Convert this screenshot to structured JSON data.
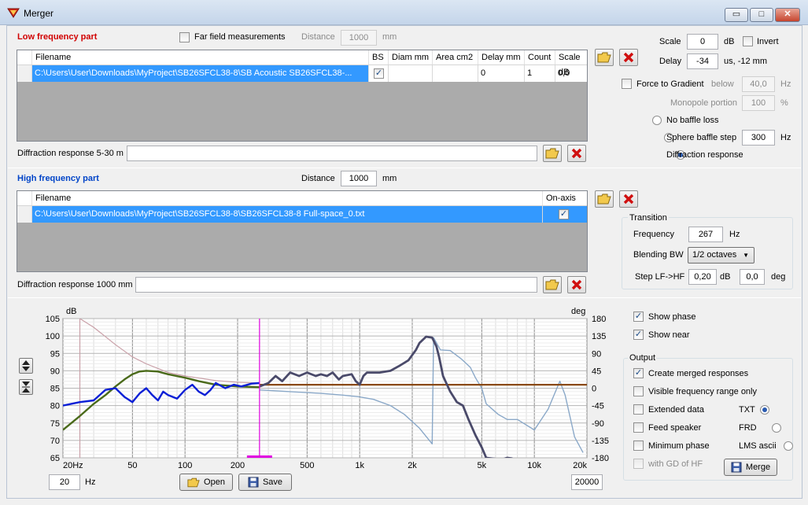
{
  "window": {
    "title": "Merger",
    "btn_min": "▭",
    "btn_max": "□",
    "btn_close": "✕"
  },
  "lf": {
    "title": "Low frequency part",
    "far_field_label": "Far field measurements",
    "distance_label": "Distance",
    "distance_value": "1000",
    "distance_unit": "mm",
    "columns": [
      "Filename",
      "BS",
      "Diam mm",
      "Area cm2",
      "Delay mm",
      "Count",
      "Scale dB"
    ],
    "row": {
      "filename": "C:\\Users\\User\\Downloads\\MyProject\\SB26SFCL38-8\\SB Acoustic SB26SFCL38-...",
      "bs": "✓",
      "diam": "",
      "area": "",
      "delay": "0",
      "count": "1",
      "scale": "0,0"
    },
    "diffraction_label": "Diffraction response 5-30 m",
    "diffraction_value": ""
  },
  "right": {
    "scale_label": "Scale",
    "scale_value": "0",
    "scale_unit": "dB",
    "invert_label": "Invert",
    "delay_label": "Delay",
    "delay_value": "-34",
    "delay_unit": "us, -12 mm",
    "force_label": "Force to Gradient",
    "below_label": "below",
    "below_value": "40,0",
    "below_unit": "Hz",
    "monopole_label": "Monopole portion",
    "monopole_value": "100",
    "monopole_unit": "%",
    "no_baffle": "No baffle loss",
    "sphere": "Sphere baffle step",
    "sphere_value": "300",
    "sphere_unit": "Hz",
    "diffraction": "Diffraction response"
  },
  "hf": {
    "title": "High frequency part",
    "distance_label": "Distance",
    "distance_value": "1000",
    "distance_unit": "mm",
    "columns": [
      "Filename",
      "On-axis"
    ],
    "row": {
      "filename": "C:\\Users\\User\\Downloads\\MyProject\\SB26SFCL38-8\\SB26SFCL38-8 Full-space_0.txt",
      "onaxis": "✓"
    },
    "diffraction_label": "Diffraction response 1000 mm",
    "diffraction_value": ""
  },
  "transition": {
    "title": "Transition",
    "freq_label": "Frequency",
    "freq_value": "267",
    "freq_unit": "Hz",
    "bw_label": "Blending BW",
    "bw_value": "1/2 octaves",
    "step_label": "Step LF->HF",
    "step_db": "0,20",
    "step_db_unit": "dB",
    "step_deg": "0,0",
    "step_deg_unit": "deg"
  },
  "chart_controls": {
    "show_phase": "Show phase",
    "show_near": "Show near",
    "output_title": "Output",
    "create_merged": "Create merged responses",
    "visible_range": "Visible frequency range only",
    "extended": "Extended data",
    "feed": "Feed speaker",
    "minimum_phase": "Minimum phase",
    "gd": "with GD of HF",
    "fmt_txt": "TXT",
    "fmt_frd": "FRD",
    "fmt_lms": "LMS ascii",
    "merge": "Merge",
    "min_freq": "20",
    "min_unit": "Hz",
    "max_freq": "20000",
    "open": "Open",
    "save": "Save"
  },
  "chart_data": {
    "type": "line",
    "ylabel_left": "dB",
    "ylabel_right": "deg",
    "ylim": [
      65,
      105
    ],
    "y_ticks": [
      "105",
      "100",
      "95",
      "90",
      "85",
      "80",
      "75",
      "70",
      "65"
    ],
    "y2lim": [
      -180,
      180
    ],
    "y2_ticks": [
      "180",
      "135",
      "90",
      "45",
      "0",
      "-45",
      "-90",
      "-135",
      "-180"
    ],
    "xlim": [
      20,
      20000
    ],
    "x_scale": "log",
    "x_ticks": [
      {
        "f": 20,
        "label": "20Hz"
      },
      {
        "f": 50,
        "label": "50"
      },
      {
        "f": 100,
        "label": "100"
      },
      {
        "f": 200,
        "label": "200"
      },
      {
        "f": 500,
        "label": "500"
      },
      {
        "f": 1000,
        "label": "1k"
      },
      {
        "f": 2000,
        "label": "2k"
      },
      {
        "f": 5000,
        "label": "5k"
      },
      {
        "f": 10000,
        "label": "10k"
      },
      {
        "f": 20000,
        "label": "20k"
      }
    ],
    "transition_freq": 267,
    "colors": {
      "lf": "#0b1fd6",
      "hf": "#4a4a6a",
      "merged": "#8a4a10",
      "lf_phase": "#c9a0a8",
      "hf_phase": "#8aa8c8",
      "near": "#4a6a1a",
      "marker": "#e000e0"
    },
    "series": [
      {
        "key": "near",
        "points": [
          [
            20,
            73
          ],
          [
            25,
            77
          ],
          [
            30,
            80.5
          ],
          [
            35,
            83
          ],
          [
            40,
            85.5
          ],
          [
            45,
            87.5
          ],
          [
            50,
            89
          ],
          [
            55,
            89.8
          ],
          [
            60,
            90
          ],
          [
            70,
            89.8
          ],
          [
            80,
            89
          ],
          [
            100,
            88
          ],
          [
            120,
            87
          ],
          [
            150,
            86
          ],
          [
            200,
            85.5
          ],
          [
            267,
            85.3
          ]
        ]
      },
      {
        "key": "lf",
        "points": [
          [
            20,
            80
          ],
          [
            25,
            81
          ],
          [
            30,
            81.5
          ],
          [
            35,
            84.5
          ],
          [
            40,
            85
          ],
          [
            45,
            82.5
          ],
          [
            50,
            81
          ],
          [
            55,
            83.5
          ],
          [
            60,
            85
          ],
          [
            65,
            83
          ],
          [
            70,
            81.5
          ],
          [
            75,
            84
          ],
          [
            80,
            83
          ],
          [
            90,
            82
          ],
          [
            100,
            84.5
          ],
          [
            110,
            86
          ],
          [
            120,
            84
          ],
          [
            130,
            83
          ],
          [
            140,
            84.5
          ],
          [
            150,
            86.5
          ],
          [
            170,
            85
          ],
          [
            190,
            86
          ],
          [
            210,
            85.5
          ],
          [
            240,
            86.3
          ],
          [
            267,
            86.5
          ]
        ]
      },
      {
        "key": "hf",
        "points": [
          [
            267,
            85.5
          ],
          [
            300,
            86.5
          ],
          [
            330,
            88.5
          ],
          [
            360,
            87
          ],
          [
            400,
            89.5
          ],
          [
            450,
            88.5
          ],
          [
            500,
            89.5
          ],
          [
            560,
            88.5
          ],
          [
            600,
            89
          ],
          [
            650,
            88.5
          ],
          [
            700,
            89.5
          ],
          [
            760,
            87.5
          ],
          [
            800,
            88.5
          ],
          [
            900,
            89
          ],
          [
            950,
            87
          ],
          [
            1000,
            86
          ],
          [
            1050,
            88.5
          ],
          [
            1100,
            89.5
          ],
          [
            1300,
            89.5
          ],
          [
            1500,
            90
          ],
          [
            1700,
            91.5
          ],
          [
            1900,
            93
          ],
          [
            2100,
            96
          ],
          [
            2200,
            98
          ],
          [
            2400,
            99.8
          ],
          [
            2600,
            99.5
          ],
          [
            2750,
            97
          ],
          [
            2850,
            94
          ],
          [
            3000,
            88.5
          ],
          [
            3300,
            84
          ],
          [
            3600,
            81
          ],
          [
            3900,
            80
          ],
          [
            4200,
            76
          ],
          [
            4600,
            71.5
          ],
          [
            5000,
            68
          ],
          [
            5300,
            65
          ],
          [
            6500,
            64.5
          ],
          [
            7000,
            65
          ],
          [
            7500,
            64.8
          ]
        ]
      },
      {
        "key": "merged",
        "points": [
          [
            267,
            86
          ],
          [
            1000,
            86
          ],
          [
            20000,
            86
          ]
        ]
      },
      {
        "key": "lf_phase",
        "points": [
          [
            25,
            105
          ],
          [
            30,
            102.5
          ],
          [
            40,
            97.5
          ],
          [
            50,
            94
          ],
          [
            60,
            92
          ],
          [
            80,
            89.5
          ],
          [
            100,
            88.5
          ],
          [
            150,
            87.2
          ],
          [
            200,
            86.7
          ],
          [
            267,
            86.5
          ]
        ]
      },
      {
        "key": "hf_phase",
        "points": [
          [
            267,
            84.5
          ],
          [
            400,
            84
          ],
          [
            600,
            83.5
          ],
          [
            800,
            83
          ],
          [
            1000,
            82.5
          ],
          [
            1200,
            81.8
          ],
          [
            1500,
            80
          ],
          [
            1800,
            77.5
          ],
          [
            2200,
            73.5
          ],
          [
            2600,
            69
          ],
          [
            2650,
            99.5
          ],
          [
            2900,
            96
          ],
          [
            3300,
            95.8
          ],
          [
            3800,
            93.5
          ],
          [
            4300,
            91
          ],
          [
            4600,
            88
          ],
          [
            5000,
            85
          ],
          [
            5300,
            80.5
          ],
          [
            6200,
            77.5
          ],
          [
            7000,
            76
          ],
          [
            8000,
            76
          ],
          [
            10000,
            73
          ],
          [
            12000,
            79
          ],
          [
            14000,
            87
          ],
          [
            15000,
            83
          ],
          [
            17000,
            71
          ],
          [
            19000,
            66.5
          ]
        ]
      }
    ]
  }
}
